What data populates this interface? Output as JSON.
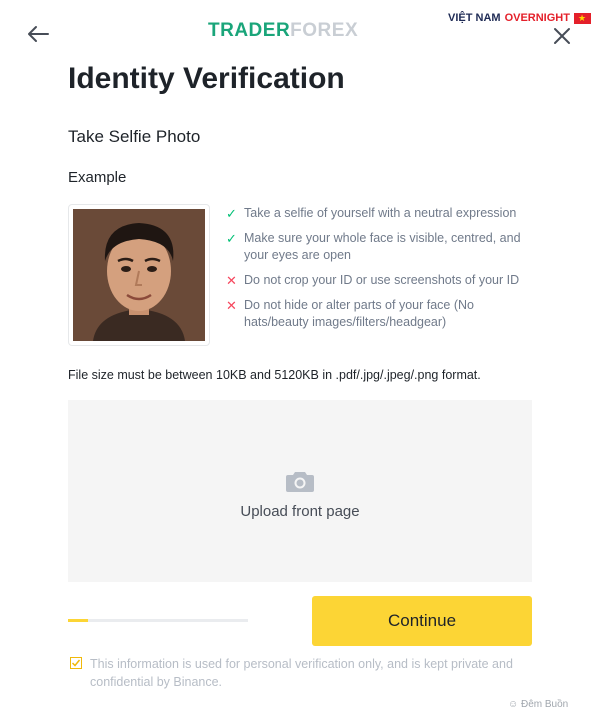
{
  "header": {
    "logo_trader": "TRADER",
    "logo_forex": "FOREX",
    "badge_country": "VIỆT NAM",
    "badge_brand": "OVERNIGHT"
  },
  "icons": {
    "back": "arrow-left-icon",
    "close": "close-icon",
    "camera": "camera-icon",
    "check": "check-icon",
    "cross": "cross-icon",
    "checkbox": "checkbox-icon"
  },
  "page": {
    "title": "Identity Verification",
    "section_title": "Take Selfie Photo",
    "example_label": "Example"
  },
  "rules": [
    {
      "status": "ok",
      "text": "Take a selfie of yourself with a neutral expression"
    },
    {
      "status": "ok",
      "text": "Make sure your whole face is visible, centred, and your eyes are open"
    },
    {
      "status": "no",
      "text": "Do not crop your ID or use screenshots of your ID"
    },
    {
      "status": "no",
      "text": "Do not hide or alter parts of your face (No hats/beauty images/filters/headgear)"
    }
  ],
  "file_note": "File size must be between 10KB and 5120KB in .pdf/.jpg/.jpeg/.png format.",
  "upload": {
    "label": "Upload front page"
  },
  "progress": {
    "fraction": 0.11
  },
  "actions": {
    "continue_label": "Continue"
  },
  "privacy_note": "This information is used for personal verification only, and is kept private and confidential by Binance.",
  "watermark": "Đêm Buồn",
  "colors": {
    "accent": "#fcd535",
    "ok": "#02c076",
    "no": "#f6465d",
    "logo_green": "#1aa57a"
  }
}
